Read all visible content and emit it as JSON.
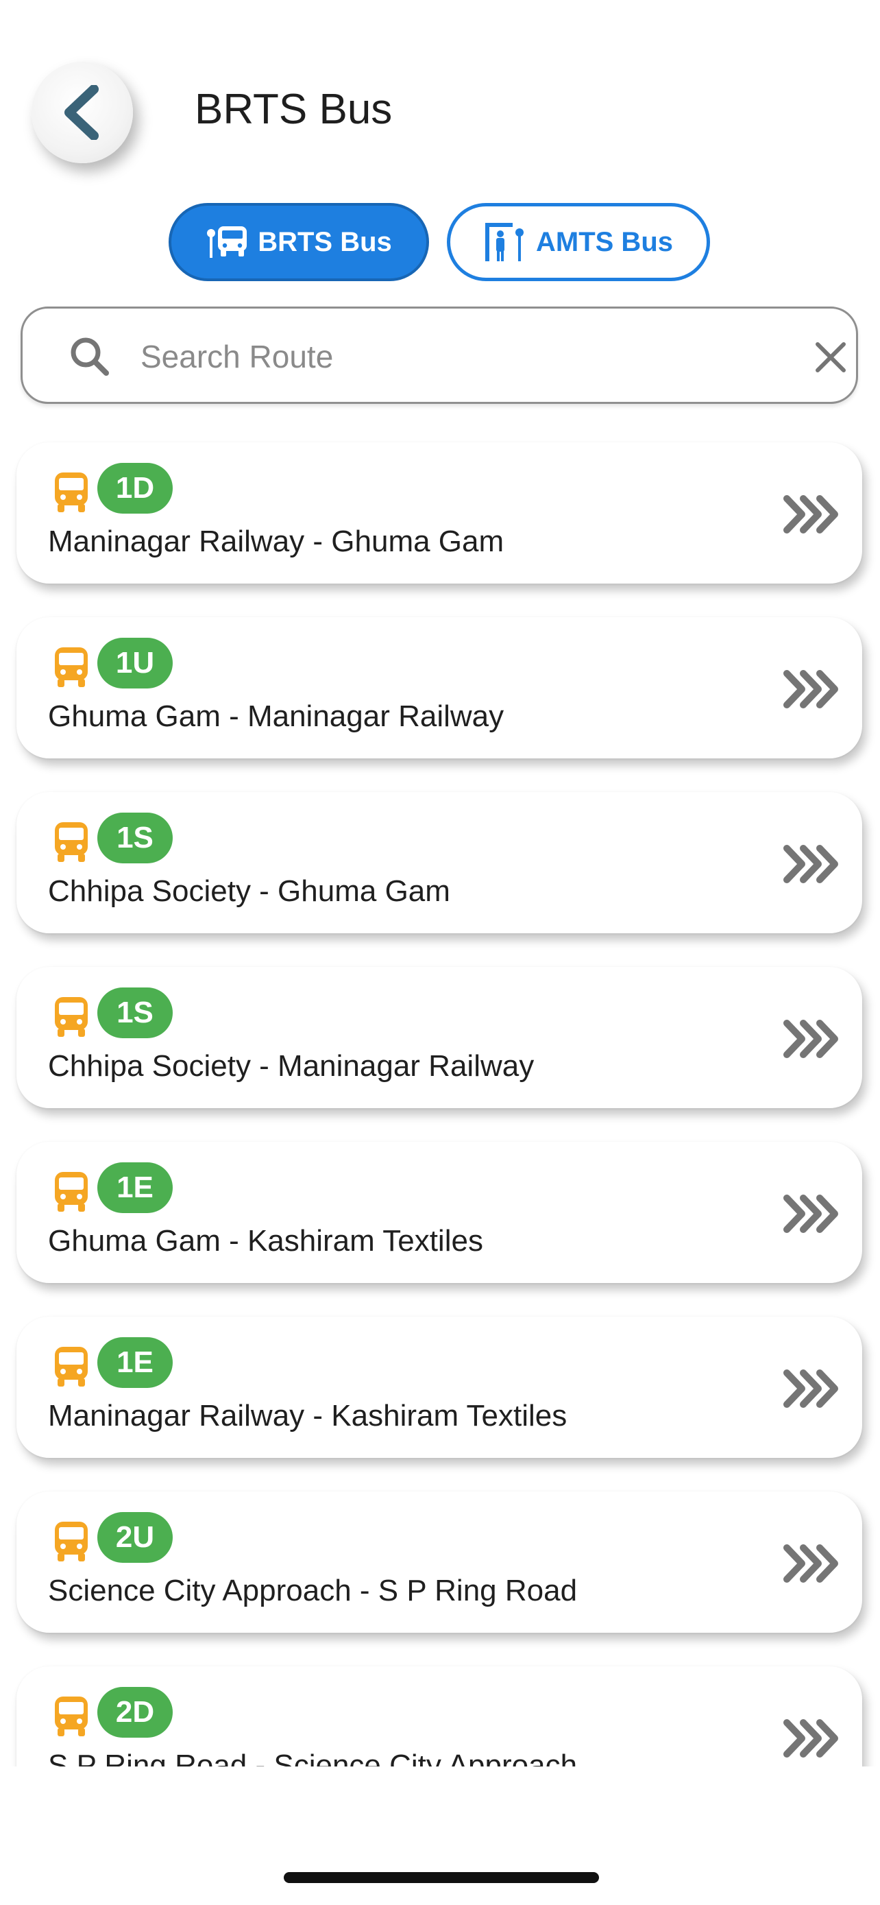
{
  "header": {
    "title": "BRTS Bus"
  },
  "tabs": [
    {
      "label": "BRTS Bus",
      "active": true
    },
    {
      "label": "AMTS Bus",
      "active": false
    }
  ],
  "search": {
    "placeholder": "Search Route",
    "value": ""
  },
  "colors": {
    "primary_blue": "#1e7fe0",
    "badge_green": "#4caf50",
    "bus_orange": "#f5a623",
    "chevron_gray": "#757575"
  },
  "icons": {
    "back": "chevron-left-icon",
    "search": "search-icon",
    "clear": "close-icon",
    "route_bus": "bus-icon",
    "route_open": "triple-chevron-right-icon"
  },
  "routes": [
    {
      "code": "1D",
      "name": "Maninagar Railway - Ghuma Gam"
    },
    {
      "code": "1U",
      "name": "Ghuma Gam - Maninagar Railway"
    },
    {
      "code": "1S",
      "name": "Chhipa Society - Ghuma Gam"
    },
    {
      "code": "1S",
      "name": "Chhipa Society - Maninagar Railway"
    },
    {
      "code": "1E",
      "name": "Ghuma Gam - Kashiram Textiles"
    },
    {
      "code": "1E",
      "name": "Maninagar Railway - Kashiram Textiles"
    },
    {
      "code": "2U",
      "name": "Science City Approach - S P Ring Road"
    },
    {
      "code": "2D",
      "name": "S P Ring Road - Science City Approach"
    }
  ]
}
